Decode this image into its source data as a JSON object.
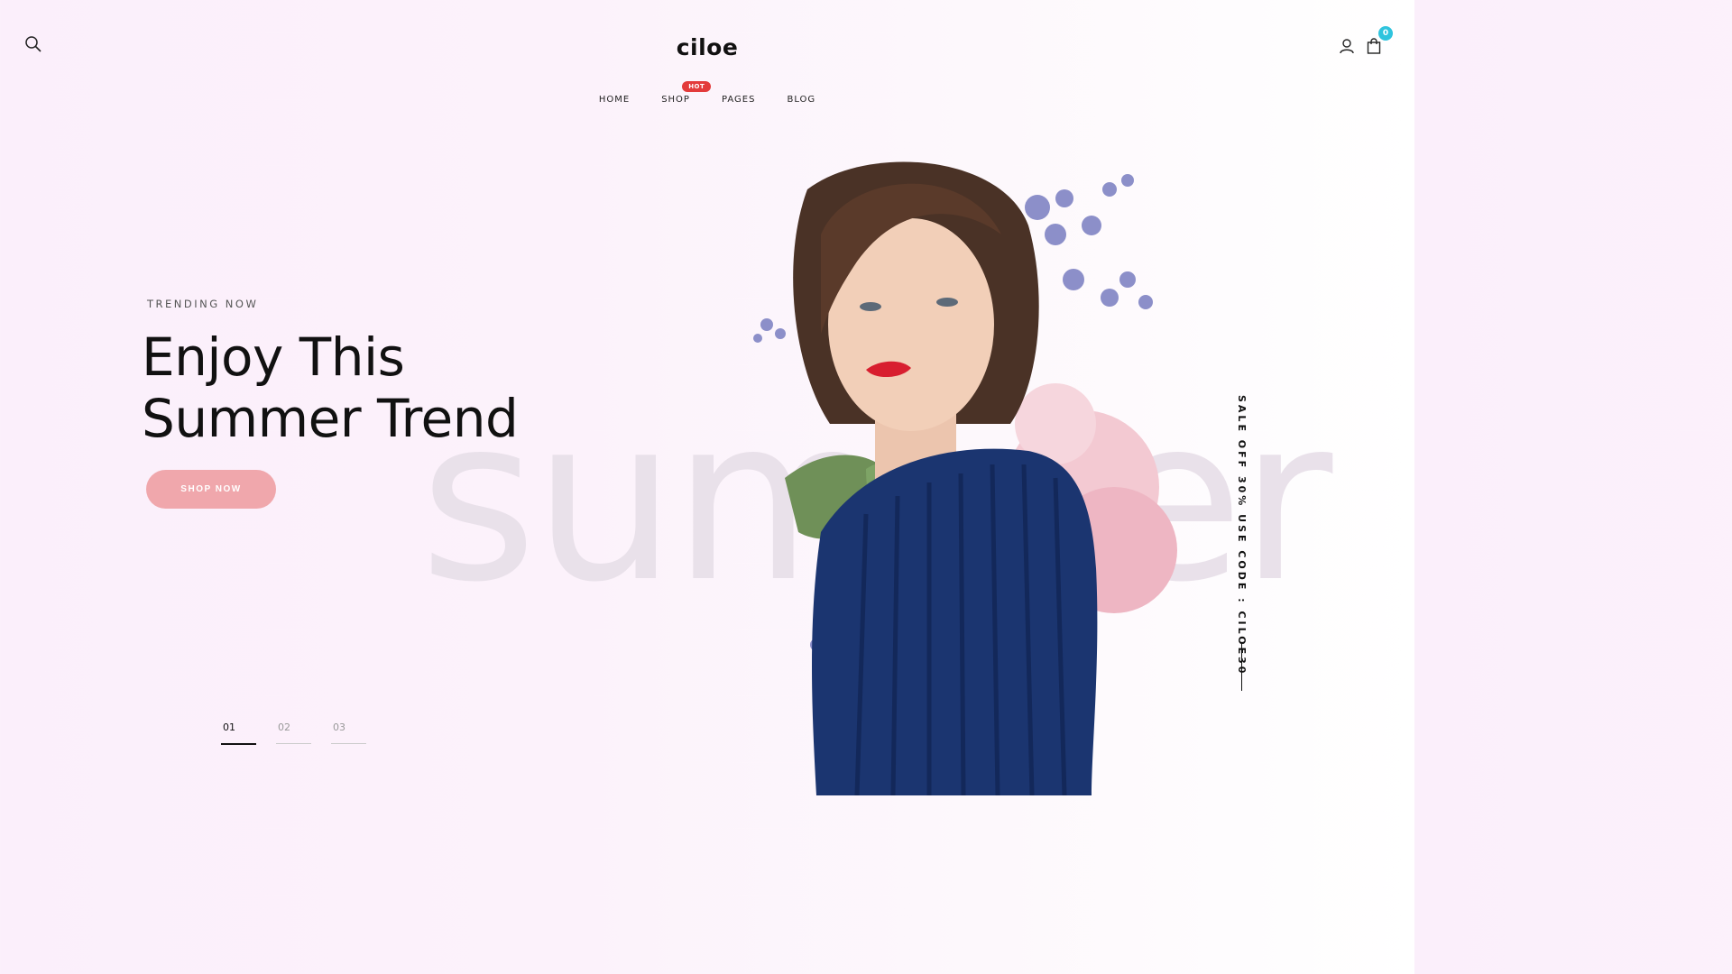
{
  "header": {
    "logo": "ciloe",
    "cart_count": "0",
    "nav": [
      {
        "label": "HOME"
      },
      {
        "label": "SHOP",
        "badge": "HOT"
      },
      {
        "label": "PAGES"
      },
      {
        "label": "BLOG"
      }
    ],
    "icons": {
      "search": "search-icon",
      "account": "user-icon",
      "cart": "shopping-bag-icon"
    }
  },
  "hero": {
    "subtitle": "TRENDING NOW",
    "headline_line1": "Enjoy This",
    "headline_line2": "Summer Trend",
    "button_label": "SHOP NOW",
    "watermark": "summer",
    "promo_vertical": "SALE OFF 30% USE CODE : CILOE30"
  },
  "pager": [
    "01",
    "02",
    "03"
  ],
  "colors": {
    "accent_button": "#f0a7ac",
    "hot_badge": "#e33b3b",
    "cart_badge": "#2fc4de",
    "shirt": "#1b3570"
  }
}
